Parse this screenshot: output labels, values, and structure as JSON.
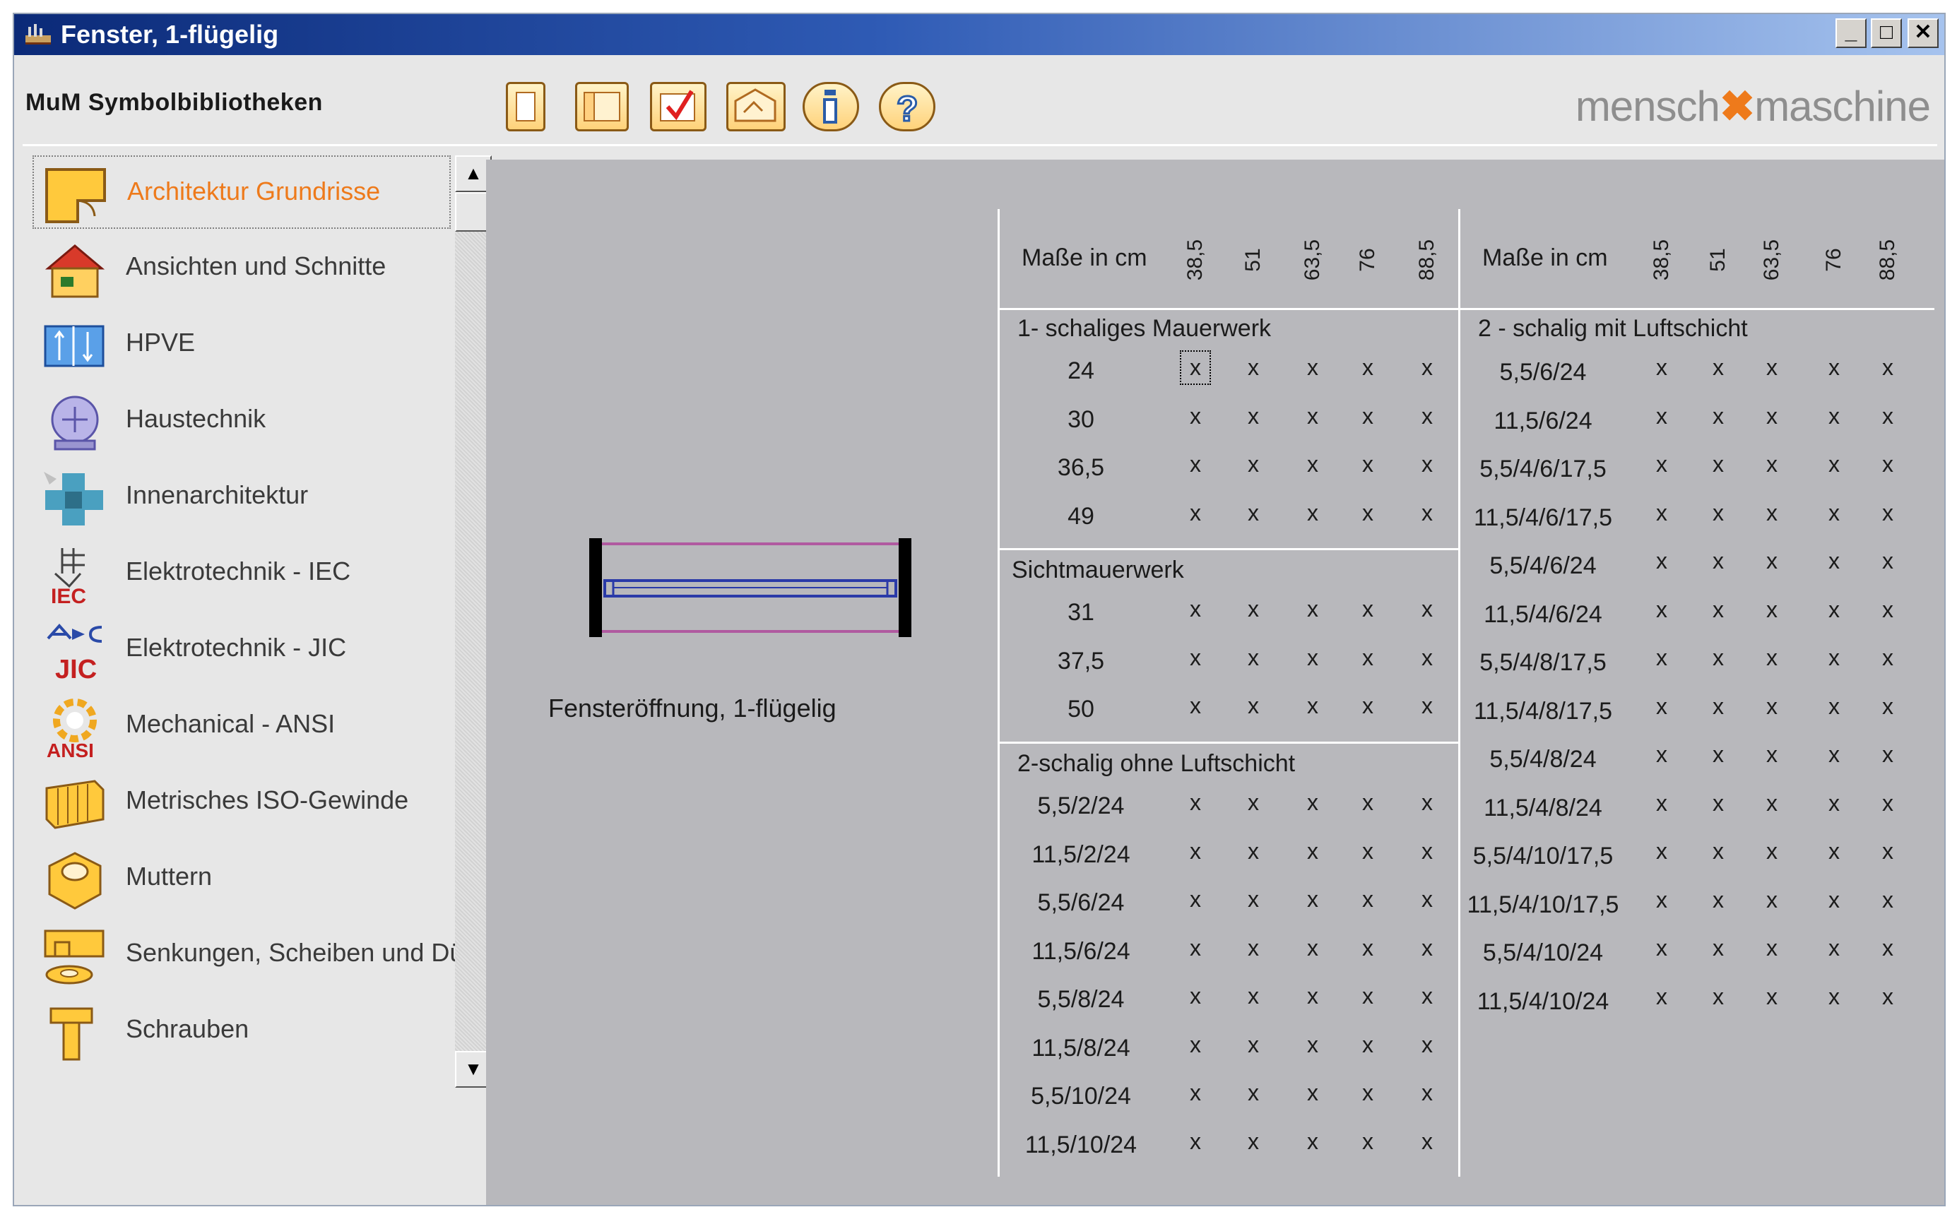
{
  "window": {
    "title": "Fenster, 1-flügelig",
    "minimize": "_",
    "maximize": "□",
    "close": "✕"
  },
  "header": {
    "library_title": "MuM Symbolbibliotheken",
    "logo_left": "mensch",
    "logo_right": "maschine"
  },
  "toolbar": {
    "buttons": [
      "new-page-icon",
      "panel-icon",
      "checkmark-icon",
      "folder-arrow-icon",
      "info-icon",
      "help-icon"
    ]
  },
  "sidebar": {
    "selected_index": 0,
    "items": [
      {
        "label": "Architektur Grundrisse",
        "icon": "floorplan-icon"
      },
      {
        "label": "Ansichten und Schnitte",
        "icon": "house-icon"
      },
      {
        "label": "HPVE",
        "icon": "ducting-icon"
      },
      {
        "label": "Haustechnik",
        "icon": "pump-icon"
      },
      {
        "label": "Innenarchitektur",
        "icon": "furniture-icon"
      },
      {
        "label": "Elektrotechnik - IEC",
        "icon": "iec-icon",
        "badge": "IEC"
      },
      {
        "label": "Elektrotechnik - JIC",
        "icon": "jic-icon",
        "badge": "JIC"
      },
      {
        "label": "Mechanical - ANSI",
        "icon": "gear-icon",
        "badge": "ANSI"
      },
      {
        "label": "Metrisches ISO-Gewinde",
        "icon": "thread-icon"
      },
      {
        "label": "Muttern",
        "icon": "nut-icon"
      },
      {
        "label": "Senkungen, Scheiben und Dübel",
        "icon": "washer-icon"
      },
      {
        "label": "Schrauben",
        "icon": "screw-icon"
      }
    ]
  },
  "preview": {
    "caption": "Fensteröffnung, 1-flügelig"
  },
  "table": {
    "header_label": "Maße in cm",
    "columns": [
      "38,5",
      "51",
      "63,5",
      "76",
      "88,5"
    ],
    "cell_mark": "x",
    "left_sections": [
      {
        "title": "1- schaliges Mauerwerk",
        "rows": [
          "24",
          "30",
          "36,5",
          "49"
        ]
      },
      {
        "title": "Sichtmauerwerk",
        "rows": [
          "31",
          "37,5",
          "50"
        ]
      },
      {
        "title": "2-schalig ohne Luftschicht",
        "rows": [
          "5,5/2/24",
          "11,5/2/24",
          "5,5/6/24",
          "11,5/6/24",
          "5,5/8/24",
          "11,5/8/24",
          "5,5/10/24",
          "11,5/10/24"
        ]
      }
    ],
    "right_section": {
      "title": "2 - schalig mit Luftschicht",
      "rows": [
        "5,5/6/24",
        "11,5/6/24",
        "5,5/4/6/17,5",
        "11,5/4/6/17,5",
        "5,5/4/6/24",
        "11,5/4/6/24",
        "5,5/4/8/17,5",
        "11,5/4/8/17,5",
        "5,5/4/8/24",
        "11,5/4/8/24",
        "5,5/4/10/17,5",
        "11,5/4/10/17,5",
        "5,5/4/10/24",
        "11,5/4/10/24"
      ]
    }
  }
}
